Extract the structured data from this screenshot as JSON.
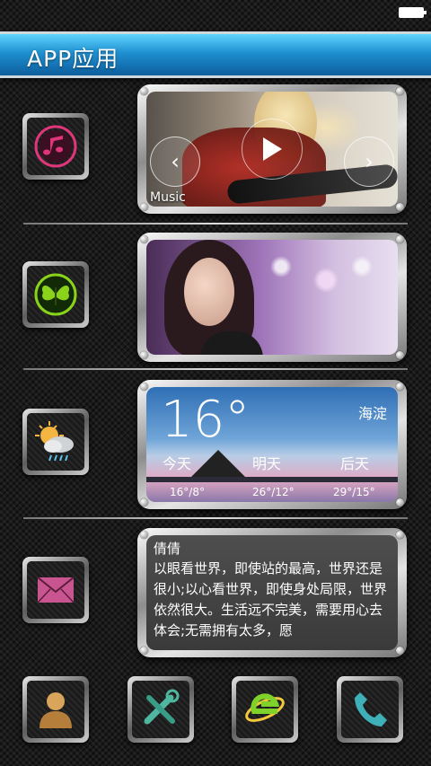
{
  "status": {
    "battery": "full"
  },
  "header": {
    "title": "APP应用"
  },
  "rows": [
    {
      "icon": "music-note-icon",
      "color": "#e0357a"
    },
    {
      "icon": "butterfly-icon",
      "color": "#8bd21a"
    },
    {
      "icon": "weather-icon",
      "color": "#f4b640"
    },
    {
      "icon": "envelope-icon",
      "color": "#c8558f"
    }
  ],
  "music": {
    "label": "Music"
  },
  "weather": {
    "temperature": "16°",
    "city": "海淀",
    "days": [
      {
        "label": "今天",
        "range": "16°/8°"
      },
      {
        "label": "明天",
        "range": "26°/12°"
      },
      {
        "label": "后天",
        "range": "29°/15°"
      }
    ]
  },
  "message": {
    "sender": "倩倩",
    "body": "以眼看世界，即使站的最高，世界还是很小;以心看世界，即使身处局限，世界依然很大。生活远不完美，需要用心去体会;无需拥有太多，愿"
  },
  "dock": [
    {
      "icon": "contacts-icon"
    },
    {
      "icon": "tools-icon"
    },
    {
      "icon": "browser-icon"
    },
    {
      "icon": "phone-icon"
    }
  ]
}
